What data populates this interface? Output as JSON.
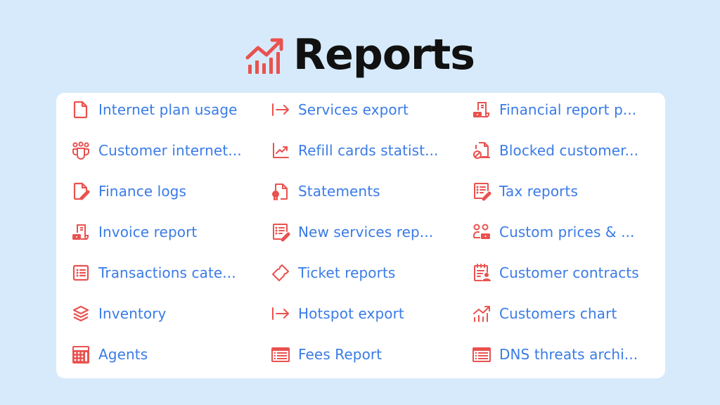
{
  "header": {
    "title": "Reports",
    "icon": "chart-growth-icon"
  },
  "colors": {
    "background": "#d7eafb",
    "card": "#ffffff",
    "icon": "#e9524f",
    "link_text": "#3a7be6",
    "title": "#111111"
  },
  "columns": [
    {
      "items": [
        {
          "label": "Internet plan usage",
          "icon": "file-icon"
        },
        {
          "label": "Customer internet...",
          "icon": "users-group-icon"
        },
        {
          "label": "Finance logs",
          "icon": "file-edit-icon"
        },
        {
          "label": "Invoice report",
          "icon": "invoice-money-icon"
        },
        {
          "label": "Transactions cate...",
          "icon": "list-icon"
        },
        {
          "label": "Inventory",
          "icon": "layers-icon"
        },
        {
          "label": "Agents",
          "icon": "calculator-icon"
        }
      ]
    },
    {
      "items": [
        {
          "label": "Services export",
          "icon": "export-arrow-icon"
        },
        {
          "label": "Refill cards statist...",
          "icon": "trend-chart-icon"
        },
        {
          "label": "Statements",
          "icon": "file-certificate-icon"
        },
        {
          "label": "New services rep...",
          "icon": "list-edit-icon"
        },
        {
          "label": "Ticket reports",
          "icon": "ticket-icon"
        },
        {
          "label": "Hotspot export",
          "icon": "export-arrow-icon"
        },
        {
          "label": "Fees Report",
          "icon": "table-list-icon"
        }
      ]
    },
    {
      "items": [
        {
          "label": "Financial report p...",
          "icon": "invoice-money-icon"
        },
        {
          "label": "Blocked customer...",
          "icon": "files-blocked-icon"
        },
        {
          "label": "Tax reports",
          "icon": "list-edit-icon"
        },
        {
          "label": "Custom prices & ...",
          "icon": "users-money-icon"
        },
        {
          "label": "Customer contracts",
          "icon": "contract-user-icon"
        },
        {
          "label": "Customers chart",
          "icon": "chart-growth-icon"
        },
        {
          "label": "DNS threats archi...",
          "icon": "table-list-icon"
        }
      ]
    }
  ]
}
